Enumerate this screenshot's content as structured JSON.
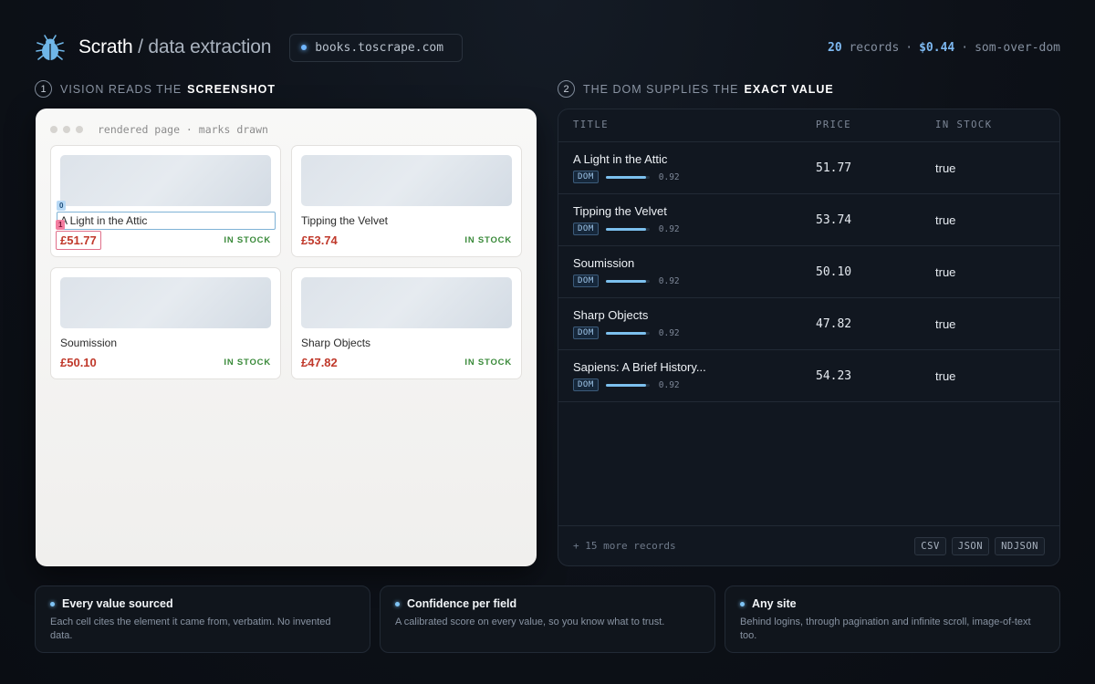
{
  "header": {
    "brand": "Scrath",
    "separator": "/",
    "subtitle": "data extraction",
    "url": "books.toscrape.com",
    "records_count": "20",
    "records_label": "records",
    "dot1": "·",
    "cost": "$0.44",
    "dot2": "·",
    "mode": "som-over-dom"
  },
  "step1": {
    "num": "1",
    "label": "VISION READS THE",
    "strong": "SCREENSHOT"
  },
  "step2": {
    "num": "2",
    "label": "THE DOM SUPPLIES THE",
    "strong": "EXACT VALUE"
  },
  "rendered_page": {
    "caption": "rendered page · marks drawn",
    "marks": {
      "title_mark": "0",
      "price_mark": "1"
    },
    "cards": [
      {
        "title": "A Light in the Attic",
        "price": "£51.77",
        "stock": "IN STOCK"
      },
      {
        "title": "Tipping the Velvet",
        "price": "£53.74",
        "stock": "IN STOCK"
      },
      {
        "title": "Soumission",
        "price": "£50.10",
        "stock": "IN STOCK"
      },
      {
        "title": "Sharp Objects",
        "price": "£47.82",
        "stock": "IN STOCK"
      }
    ]
  },
  "table": {
    "columns": [
      "TITLE",
      "PRICE",
      "IN STOCK"
    ],
    "rows": [
      {
        "title": "A Light in the Attic",
        "source": "DOM",
        "confidence": "0.92",
        "price": "51.77",
        "in_stock": "true"
      },
      {
        "title": "Tipping the Velvet",
        "source": "DOM",
        "confidence": "0.92",
        "price": "53.74",
        "in_stock": "true"
      },
      {
        "title": "Soumission",
        "source": "DOM",
        "confidence": "0.92",
        "price": "50.10",
        "in_stock": "true"
      },
      {
        "title": "Sharp Objects",
        "source": "DOM",
        "confidence": "0.92",
        "price": "47.82",
        "in_stock": "true"
      },
      {
        "title": "Sapiens: A Brief History...",
        "source": "DOM",
        "confidence": "0.92",
        "price": "54.23",
        "in_stock": "true"
      }
    ],
    "footer": {
      "more": "+ 15 more records",
      "exports": [
        "CSV",
        "JSON",
        "NDJSON"
      ]
    }
  },
  "features": [
    {
      "title": "Every value sourced",
      "desc": "Each cell cites the element it came from, verbatim. No invented data."
    },
    {
      "title": "Confidence per field",
      "desc": "A calibrated score on every value, so you know what to trust."
    },
    {
      "title": "Any site",
      "desc": "Behind logins, through pagination and infinite scroll, image-of-text too."
    }
  ],
  "colors": {
    "accent": "#7db8f0",
    "price_red": "#c0392b",
    "stock_green": "#3a8a3a",
    "bg": "#0d1118"
  },
  "icons": {
    "logo": "beetle-icon",
    "url_status": "status-dot-icon"
  }
}
